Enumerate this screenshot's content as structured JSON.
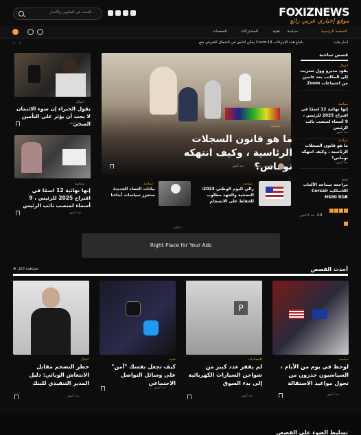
{
  "brand": {
    "name": "FOXIZNEWS",
    "tagline": "موقع إخباري عربي رائع",
    "accent": "#f6a02b"
  },
  "search": {
    "placeholder": "البحث في العناوين والأخبار..."
  },
  "nav": {
    "items": [
      "الصفحة الرئيسية",
      "سياسة",
      "تقنية",
      "المشتركات",
      "الصفحات"
    ],
    "active": 0
  },
  "ticker": {
    "label": "أخبار هامة",
    "text": "يمكن للناس في الشمال الشرقي منع Covid-19 باتباع هذه الإجراءات"
  },
  "left_cards": [
    {
      "category": "اعمال",
      "title": "يقول الخبراء إن سوء الائتمان لا يجب أن يؤثر على التأمين الصحي",
      "meta": "منذ أشهر"
    },
    {
      "category": "سياسة",
      "title": "إنها نهائية 12 اسمًا في اقتراح 2025 للرئيس ، 9 أسماء لمنصب نائب الرئيس",
      "meta": "منذ أشهر"
    }
  ],
  "hero": {
    "category": "سياسة",
    "title": "ما هو قانون السجلات الرئاسية ، وكيف انتهكه توماس؟",
    "author": "أبو الحسن منيسة",
    "time": "منذ أشهر"
  },
  "mini_cards": [
    {
      "category": "سياسة",
      "title": "رالي اليوم الوطني 2023: التضحية والجهد مطلوب للحفاظ على الانسجام"
    },
    {
      "category": "سياسة",
      "title": "بيانات التصاد الجديدة ستعزز سياسات أبناءنا"
    }
  ],
  "sidebar": {
    "heading": "قصص ساخنة",
    "items": [
      {
        "category": "اعمال",
        "title": "يقود مديرو وول ستريت إلى المكاتب بعد عامين من اجتماعات Zoom",
        "meta": "منذ أشهر"
      },
      {
        "category": "سياسة",
        "title": "إنها نهائية 12 اسمًا في اقتراح 2025 للرئيس ، 9 أسماء لمنصب نائب الرئيس",
        "meta": "منذ أشهر"
      },
      {
        "category": "سياسة",
        "title": "ما هو قانون السجلات الرئاسية ، وكيف انتهكه توماس؟",
        "meta": "منذ أشهر"
      },
      {
        "category": "تقنية",
        "title": "مراجعة سماعة الألعاب اللاسلكية Corsair HS80 RGB",
        "meta": "منذ 4 أشهر",
        "rating": "4.8"
      }
    ]
  },
  "ad": {
    "label": "- إعلان -",
    "text": "Right Place for Your Ads"
  },
  "latest": {
    "heading": "أحدث القصص",
    "more": "مشاهدة الكل",
    "cards": [
      {
        "category": "سياسة",
        "title": "لوحظ في يوم من الأيام ، السياسيون حذرون من تحول مواعيد الاستقالة",
        "meta": "منذ أشهر"
      },
      {
        "category": "اقتصاديات",
        "title": "لم يقفز عدد كبير من شواحن السيارات الكهربائية إلى بدء السوق",
        "meta": "منذ أشهر"
      },
      {
        "category": "تقنية",
        "title": "كيف تجعل نفسك \"آمن\" على وسائل التواصل الاجتماعي",
        "meta": "منذ أشهر"
      },
      {
        "category": "اعمال",
        "title": "خطر التضخم مقابل الانتعاش الوبائي: دليل المدير التنفيذي للبنك",
        "meta": "منذ أشهر"
      }
    ]
  },
  "footer": {
    "heading": "تسليط الضوء على القصص"
  }
}
